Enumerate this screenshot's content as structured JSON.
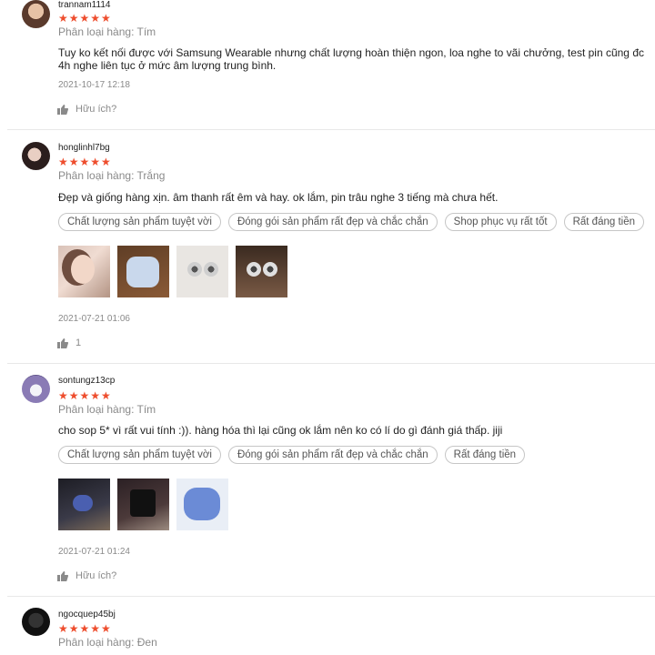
{
  "reviews": [
    {
      "username": "trannam1114",
      "stars": "★★★★★",
      "variation": "Phân loại hàng: Tím",
      "comment": "Tuy ko kết nối được với Samsung Wearable nhưng chất lượng hoàn thiện ngon, loa nghe to vãi chưởng, test pin cũng đc 4h nghe liên tục ở mức âm lượng trung bình.",
      "timestamp": "2021-10-17 12:18",
      "like_label": "Hữu ích?"
    },
    {
      "username": "honglinhl7bg",
      "stars": "★★★★★",
      "variation": "Phân loại hàng: Trắng",
      "comment": "Đẹp và giống hàng xịn. âm thanh rất êm và hay. ok lắm, pin trâu nghe 3 tiếng mà chưa hết.",
      "tags": [
        "Chất lượng sản phẩm tuyệt vời",
        "Đóng gói sản phẩm rất đẹp và chắc chắn",
        "Shop phục vụ rất tốt",
        "Rất đáng tiền"
      ],
      "timestamp": "2021-07-21 01:06",
      "like_label": "1"
    },
    {
      "username": "sontungz13cp",
      "stars": "★★★★★",
      "variation": "Phân loại hàng: Tím",
      "comment": "cho sop 5* vì rất vui tính :)). hàng hóa thì lại cũng ok lắm nên ko có lí do gì đánh giá thấp. jiji",
      "tags": [
        "Chất lượng sản phẩm tuyệt vời",
        "Đóng gói sản phẩm rất đẹp và chắc chắn",
        "Rất đáng tiền"
      ],
      "timestamp": "2021-07-21 01:24",
      "like_label": "Hữu ích?"
    },
    {
      "username": "ngocquep45bj",
      "stars": "★★★★★",
      "variation": "Phân loại hàng: Đen"
    }
  ],
  "colors": {
    "star": "#ee4d2d",
    "muted": "#8a8a8a",
    "border": "#c6c6c6"
  },
  "icons": {
    "like": "thumbs-up-icon",
    "more": "more-vertical-icon"
  }
}
